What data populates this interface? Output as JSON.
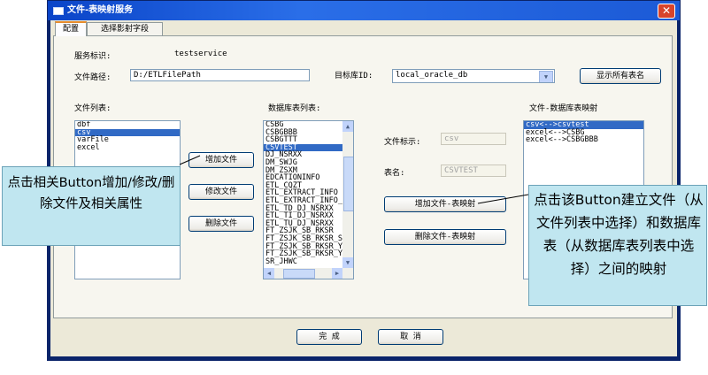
{
  "window": {
    "title": "文件-表映射服务",
    "close_glyph": "✕"
  },
  "tabs": [
    {
      "label": "配置",
      "active": true
    },
    {
      "label": "选择影射字段",
      "active": false
    }
  ],
  "form": {
    "service_id_label": "服务标识:",
    "service_id_value": "testservice",
    "file_path_label": "文件路径:",
    "file_path_value": "D:/ETLFilePath",
    "target_db_label": "目标库ID:",
    "target_db_value": "local_oracle_db",
    "show_all_tables_button": "显示所有表名"
  },
  "file_list": {
    "label": "文件列表:",
    "items": [
      "dbf",
      "csv",
      "varFile",
      "excel"
    ],
    "selected_index": 1
  },
  "file_buttons": {
    "add": "增加文件",
    "edit": "修改文件",
    "delete": "删除文件"
  },
  "db_table_list": {
    "label": "数据库表列表:",
    "items": [
      "CSBG",
      "CSBGBBB",
      "CSBGTTT",
      "CSVTEST",
      "DJ_NSRXX",
      "DM_SWJG",
      "DM_ZSXM",
      "EDCATIONINFO",
      "ETL_CQZT",
      "ETL_EXTRACT_INFO",
      "ETL_EXTRACT_INFO_L",
      "ETL_TD_DJ_NSRXX",
      "ETL_TI_DJ_NSRXX",
      "ETL_TU_DJ_NSRXX",
      "FT_ZSJK_SB_RKSR",
      "FT_ZSJK_SB_RKSR_SU",
      "FT_ZSJK_SB_RKSR_YF",
      "FT_ZSJK_SB_RKSR_YF",
      "SR_JHWC"
    ],
    "selected_index": 3
  },
  "mapping_fields": {
    "file_tag_label": "文件标示:",
    "file_tag_value": "csv",
    "table_name_label": "表名:",
    "table_name_value": "CSVTEST",
    "add_mapping_button": "增加文件-表映射",
    "delete_mapping_button": "删除文件-表映射"
  },
  "mapping_list": {
    "label": "文件-数据库表映射",
    "items": [
      "csv<-->csvtest",
      "excel<-->CSBG",
      "excel<-->CSBGBBB"
    ],
    "selected_index": 0
  },
  "footer": {
    "ok_button": "完 成",
    "cancel_button": "取 消"
  },
  "callouts": {
    "left": "点击相关Button增加/修改/删除文件及相关属性",
    "right": "点击该Button建立文件（从文件列表中选择）和数据库表（从数据库表列表中选择）之间的映射"
  }
}
